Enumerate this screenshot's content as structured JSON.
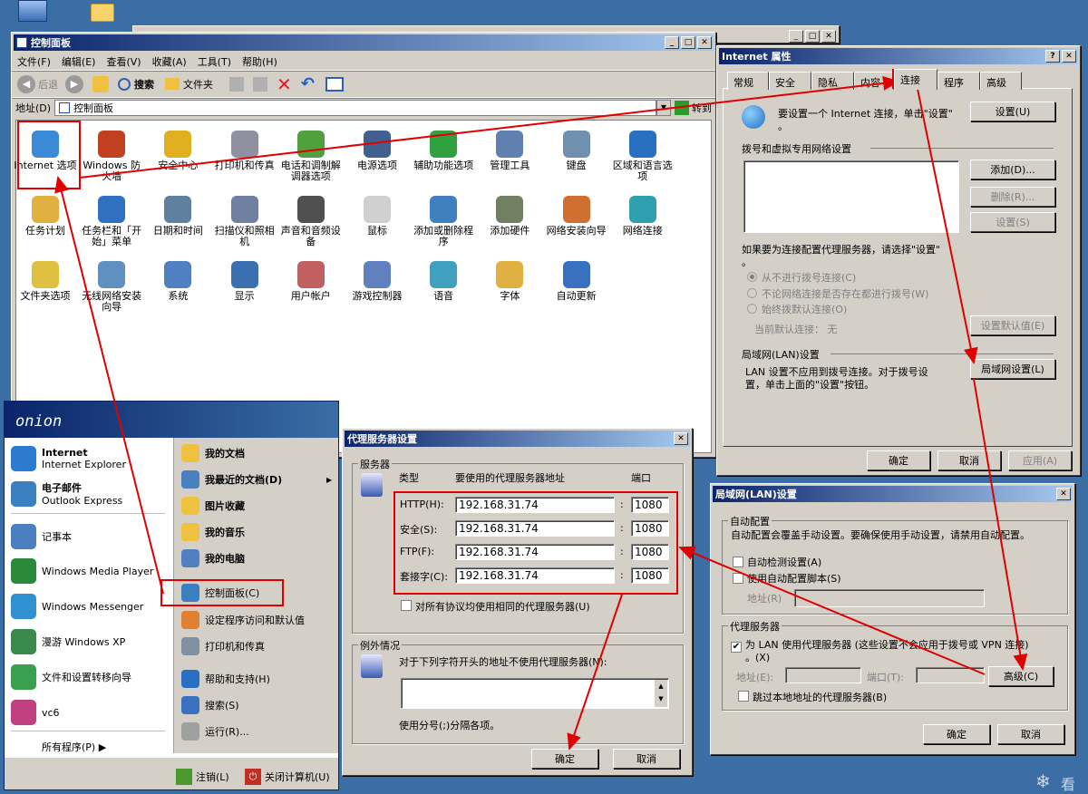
{
  "desktop": {
    "watermark": "看"
  },
  "control_panel": {
    "title": "控制面板",
    "menu": [
      "文件(F)",
      "编辑(E)",
      "查看(V)",
      "收藏(A)",
      "工具(T)",
      "帮助(H)"
    ],
    "toolbar": {
      "back": "后退",
      "search": "搜索",
      "folders": "文件夹"
    },
    "address_label": "地址(D)",
    "address_value": "控制面板",
    "go": "转到",
    "items": [
      "Internet 选项",
      "Windows 防火墙",
      "安全中心",
      "打印机和传真",
      "电话和调制解调器选项",
      "电源选项",
      "辅助功能选项",
      "管理工具",
      "键盘",
      "区域和语言选项",
      "任务计划",
      "任务栏和「开始」菜单",
      "日期和时间",
      "扫描仪和照相机",
      "声音和音频设备",
      "鼠标",
      "添加或删除程序",
      "添加硬件",
      "网络安装向导",
      "网络连接",
      "文件夹选项",
      "无线网络安装向导",
      "系统",
      "显示",
      "用户帐户",
      "游戏控制器",
      "语音",
      "字体",
      "自动更新"
    ]
  },
  "start_menu": {
    "user": "onion",
    "left": [
      {
        "t": "Internet",
        "s": "Internet Explorer"
      },
      {
        "t": "电子邮件",
        "s": "Outlook Express"
      },
      {
        "t": "记事本"
      },
      {
        "t": "Windows Media Player"
      },
      {
        "t": "Windows Messenger"
      },
      {
        "t": "漫游 Windows XP"
      },
      {
        "t": "文件和设置转移向导"
      },
      {
        "t": "vc6"
      }
    ],
    "all_programs": "所有程序(P)",
    "right": [
      "我的文档",
      "我最近的文档(D)",
      "图片收藏",
      "我的音乐",
      "我的电脑",
      "控制面板(C)",
      "设定程序访问和默认值",
      "打印机和传真",
      "帮助和支持(H)",
      "搜索(S)",
      "运行(R)..."
    ],
    "logoff": "注销(L)",
    "shutdown": "关闭计算机(U)"
  },
  "inet": {
    "title": "Internet 属性",
    "tabs": [
      "常规",
      "安全",
      "隐私",
      "内容",
      "连接",
      "程序",
      "高级"
    ],
    "setup_text": "要设置一个 Internet 连接，单击\"设置\"",
    "setup_dot": "。",
    "setup_btn": "设置(U)",
    "dialup_group": "拨号和虚拟专用网络设置",
    "add": "添加(D)...",
    "remove": "删除(R)...",
    "settings": "设置(S)",
    "proxy_text1": "如果要为连接配置代理服务器，请选择\"设置\"",
    "proxy_text2": "。",
    "radio": [
      "从不进行拨号连接(C)",
      "不论网络连接是否存在都进行拨号(W)",
      "始终拨默认连接(O)"
    ],
    "current_default": "当前默认连接：  无",
    "set_default": "设置默认值(E)",
    "lan_group": "局域网(LAN)设置",
    "lan_text1": "LAN 设置不应用到拨号连接。对于拨号设",
    "lan_text2": "置，单击上面的\"设置\"按钮。",
    "lan_btn": "局域网设置(L)",
    "ok": "确定",
    "cancel": "取消",
    "apply": "应用(A)"
  },
  "lan": {
    "title": "局域网(LAN)设置",
    "auto_group": "自动配置",
    "auto_text": "自动配置会覆盖手动设置。要确保使用手动设置，请禁用自动配置。",
    "auto_detect": "自动检测设置(A)",
    "auto_script": "使用自动配置脚本(S)",
    "address": "地址(R)",
    "proxy_group": "代理服务器",
    "use_proxy1": "为 LAN 使用代理服务器 (这些设置不会应用于拨号或 VPN 连接)",
    "use_proxy2": "。(X)",
    "addr": "地址(E):",
    "port": "端口(T):",
    "advanced": "高级(C)",
    "bypass": "跳过本地地址的代理服务器(B)",
    "ok": "确定",
    "cancel": "取消"
  },
  "proxy": {
    "title": "代理服务器设置",
    "servers_group": "服务器",
    "col_type": "类型",
    "col_addr": "要使用的代理服务器地址",
    "col_port": "端口",
    "rows": [
      {
        "type": "HTTP(H):",
        "addr": "192.168.31.74",
        "port": "1080"
      },
      {
        "type": "安全(S):",
        "addr": "192.168.31.74",
        "port": "1080"
      },
      {
        "type": "FTP(F):",
        "addr": "192.168.31.74",
        "port": "1080"
      },
      {
        "type": "套接字(C):",
        "addr": "192.168.31.74",
        "port": "1080"
      }
    ],
    "same_for_all": "对所有协议均使用相同的代理服务器(U)",
    "exceptions_group": "例外情况",
    "exceptions_text": "对于下列字符开头的地址不使用代理服务器(N):",
    "sep_text": "使用分号(;)分隔各项。",
    "ok": "确定",
    "cancel": "取消"
  }
}
